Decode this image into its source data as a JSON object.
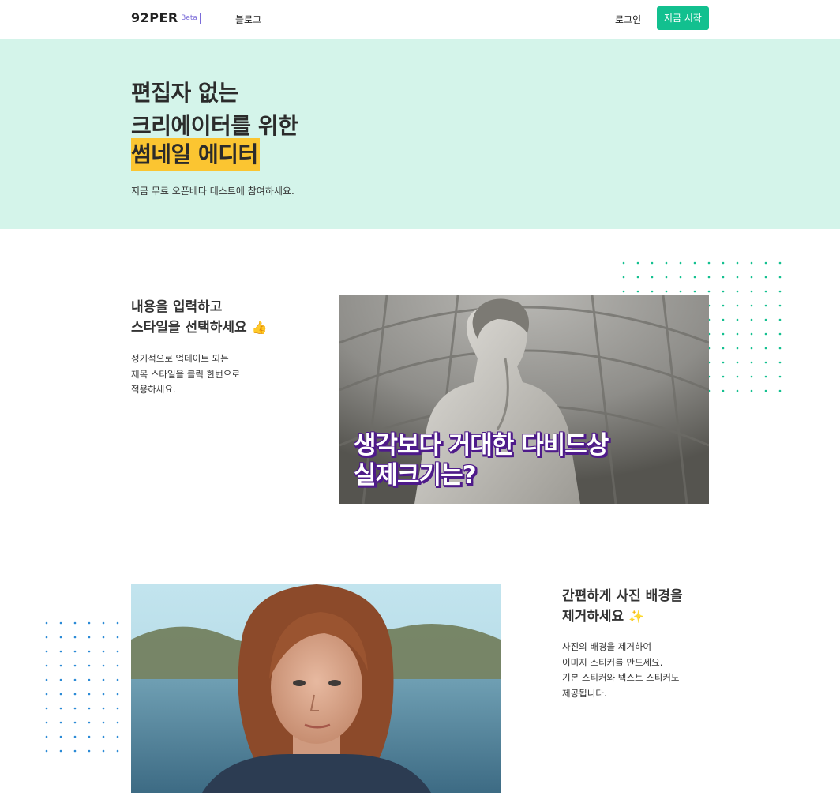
{
  "header": {
    "logo": "92PER",
    "beta_badge": "Beta",
    "nav_blog": "블로그",
    "nav_login": "로그인",
    "cta_button": "지금 시작"
  },
  "hero": {
    "line1": "편집자 없는",
    "line2": "크리에이터를 위한",
    "line3_highlight": "썸네일 에디터",
    "subtitle": "지금 무료 오픈베타 테스트에 참여하세요."
  },
  "feature1": {
    "title_line1": "내용을 입력하고",
    "title_line2": "스타일을 선택하세요",
    "title_emoji": "👍",
    "desc_lines": [
      "정기적으로 업데이트 되는",
      "제목 스타일을 클릭 한번으로",
      "적용하세요."
    ],
    "image_text_line1": "생각보다 거대한 다비드상",
    "image_text_line2": "실제크기는?"
  },
  "feature2": {
    "title_line1": "간편하게 사진 배경을",
    "title_line2": "제거하세요",
    "title_emoji": "✨",
    "desc_lines": [
      "사진의 배경을 제거하여",
      "이미지 스티커를 만드세요.",
      "기본 스티커와 텍스트 스티커도",
      "제공됩니다."
    ]
  },
  "colors": {
    "brand_green": "#12c08f",
    "hero_bg": "#d4f4ea",
    "highlight_yellow": "#fbc531",
    "beta_purple": "#7b6cd9",
    "dot_green": "#12c08f",
    "dot_blue": "#2a8ad6",
    "text_outline_purple": "#4e1a8a"
  }
}
